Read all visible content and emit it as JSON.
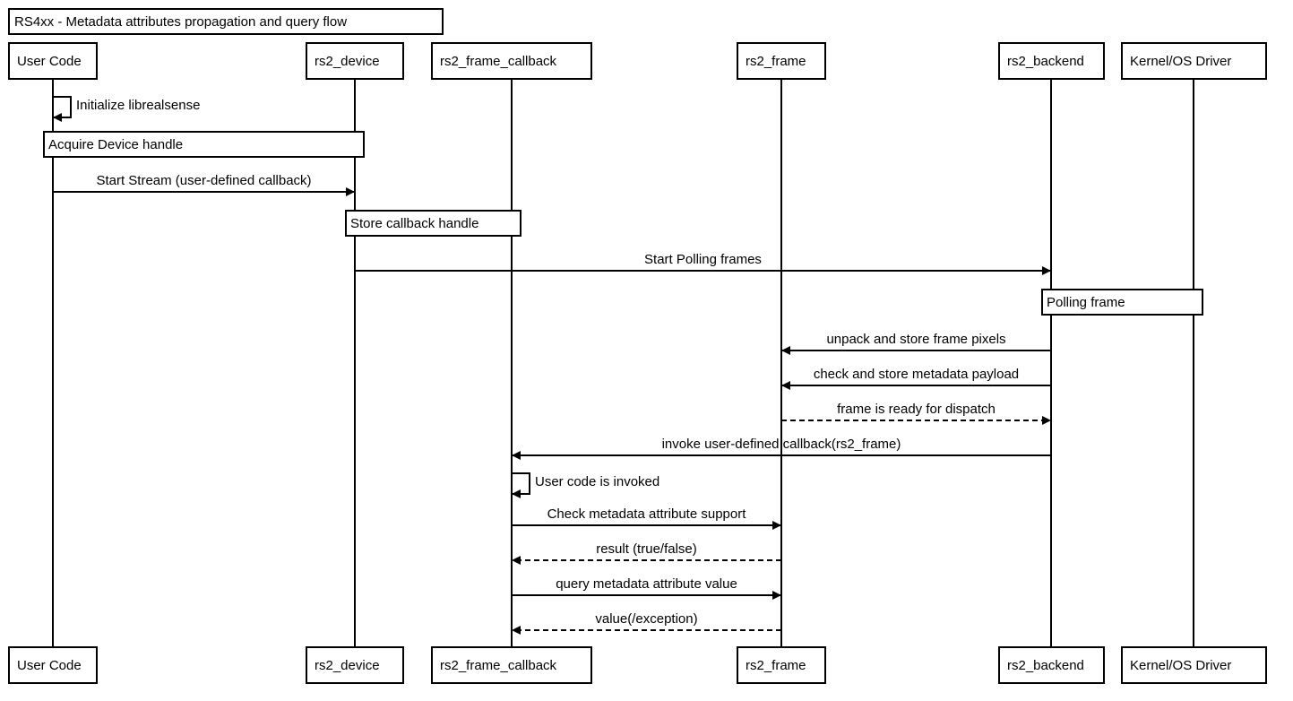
{
  "title": "RS4xx - Metadata attributes propagation and query flow",
  "participants": [
    {
      "id": "user",
      "label": "User Code"
    },
    {
      "id": "device",
      "label": "rs2_device"
    },
    {
      "id": "callback",
      "label": "rs2_frame_callback"
    },
    {
      "id": "frame",
      "label": "rs2_frame"
    },
    {
      "id": "backend",
      "label": "rs2_backend"
    },
    {
      "id": "driver",
      "label": "Kernel/OS Driver"
    }
  ],
  "steps": [
    {
      "type": "self",
      "from": "user",
      "label": "Initialize librealsense"
    },
    {
      "type": "note",
      "from": "user",
      "to": "device",
      "label": "Acquire Device handle"
    },
    {
      "type": "message",
      "from": "user",
      "to": "device",
      "label": "Start Stream (user-defined callback)",
      "style": "solid"
    },
    {
      "type": "note",
      "from": "device",
      "to": "callback",
      "label": "Store callback handle"
    },
    {
      "type": "message",
      "from": "device",
      "to": "backend",
      "label": "Start Polling frames",
      "style": "solid"
    },
    {
      "type": "note",
      "from": "backend",
      "to": "driver",
      "label": "Polling frame"
    },
    {
      "type": "message",
      "from": "backend",
      "to": "frame",
      "label": "unpack and store frame pixels",
      "style": "solid"
    },
    {
      "type": "message",
      "from": "backend",
      "to": "frame",
      "label": "check and store metadata payload",
      "style": "solid"
    },
    {
      "type": "message",
      "from": "frame",
      "to": "backend",
      "label": "frame is ready for dispatch",
      "style": "dashed"
    },
    {
      "type": "message",
      "from": "backend",
      "to": "callback",
      "label": "invoke user-defined callback(rs2_frame)",
      "style": "solid"
    },
    {
      "type": "self",
      "from": "callback",
      "label": "User code is invoked"
    },
    {
      "type": "message",
      "from": "callback",
      "to": "frame",
      "label": "Check metadata attribute support",
      "style": "solid"
    },
    {
      "type": "message",
      "from": "frame",
      "to": "callback",
      "label": "result (true/false)",
      "style": "dashed"
    },
    {
      "type": "message",
      "from": "callback",
      "to": "frame",
      "label": "query metadata attribute value",
      "style": "solid"
    },
    {
      "type": "message",
      "from": "frame",
      "to": "callback",
      "label": "value(/exception)",
      "style": "dashed"
    }
  ]
}
